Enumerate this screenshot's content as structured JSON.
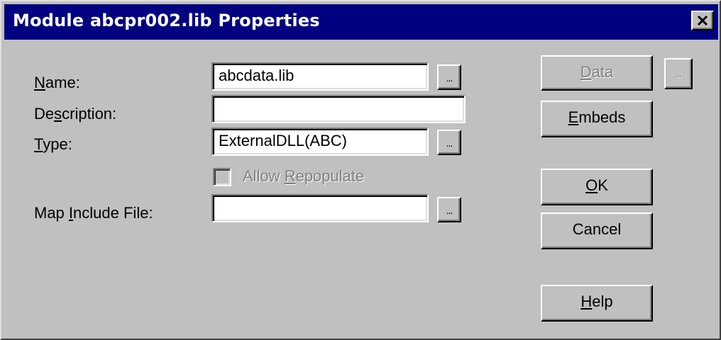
{
  "window": {
    "title": "Module abcpr002.lib Properties",
    "close_glyph": "×"
  },
  "form": {
    "name_label_pre": "",
    "name_label_key": "N",
    "name_label_post": "ame:",
    "name_value": "abcdata.lib",
    "description_label_pre": "De",
    "description_label_key": "s",
    "description_label_post": "cription:",
    "description_value": "",
    "type_label_pre": "",
    "type_label_key": "T",
    "type_label_post": "ype:",
    "type_value": "ExternalDLL(ABC)",
    "allow_repopulate_pre": "Allow ",
    "allow_repopulate_key": "R",
    "allow_repopulate_post": "epopulate",
    "allow_repopulate_checked": false,
    "map_include_label_pre": "Map ",
    "map_include_label_key": "I",
    "map_include_label_post": "nclude File:",
    "map_include_value": "",
    "ellipsis": "..."
  },
  "buttons": {
    "data_key": "D",
    "data_rest": "ata",
    "embeds_key": "E",
    "embeds_rest": "mbeds",
    "ok_key": "O",
    "ok_rest": "K",
    "cancel": "Cancel",
    "help_key": "H",
    "help_rest": "elp",
    "data_ellipsis": "..."
  },
  "colors": {
    "titlebar": "#000080",
    "face": "#c0c0c0",
    "disabled_text": "#808080"
  }
}
